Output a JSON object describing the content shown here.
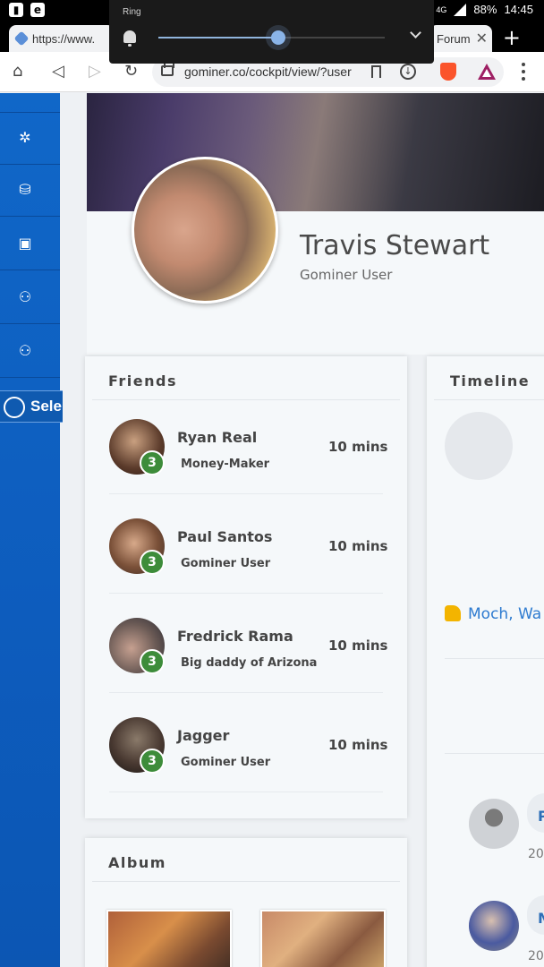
{
  "status_bar": {
    "battery": "88%",
    "time": "14:45",
    "network": "4G"
  },
  "volume_overlay": {
    "label": "Ring",
    "level": 0.53
  },
  "tabs": [
    {
      "label": "https://www."
    },
    {
      "label": "Forum"
    }
  ],
  "url": "gominer.co/cockpit/view/?user",
  "sidebar": {
    "select_label": "Sele"
  },
  "profile": {
    "name": "Travis Stewart",
    "role": "Gominer User"
  },
  "friends": {
    "title": "Friends",
    "items": [
      {
        "name": "Ryan Real",
        "title": "Money-Maker",
        "badge": "3",
        "time": "10 mins"
      },
      {
        "name": "Paul Santos",
        "title": "Gominer User",
        "badge": "3",
        "time": "10 mins"
      },
      {
        "name": "Fredrick Rama",
        "title": "Big daddy of Arizona",
        "badge": "3",
        "time": "10 mins"
      },
      {
        "name": "Jagger",
        "title": "Gominer User",
        "badge": "3",
        "time": "10 mins"
      }
    ]
  },
  "album": {
    "title": "Album"
  },
  "timeline": {
    "title": "Timeline",
    "like_text": "Moch, Wa",
    "entries": [
      {
        "letter": "P",
        "year": "20"
      },
      {
        "letter": "M",
        "year": "20"
      }
    ]
  }
}
